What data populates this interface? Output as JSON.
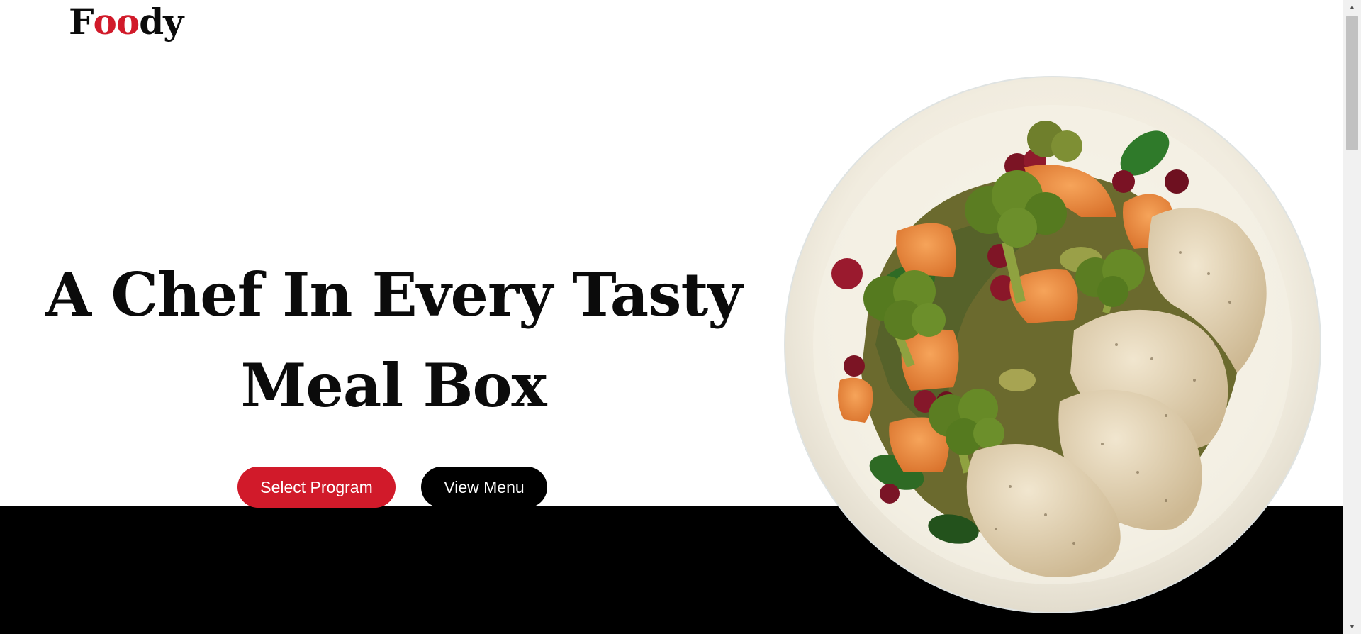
{
  "brand": {
    "logo_letters": [
      "F",
      "o",
      "o",
      "d",
      "y"
    ],
    "logo_accent_color": "#d11a2a",
    "logo_base_color": "#0b0b0b"
  },
  "hero": {
    "title_line_1": "A Chef In Every Tasty",
    "title_line_2": "Meal Box",
    "primary_button_label": "Select Program",
    "secondary_button_label": "View Menu",
    "primary_color": "#d11a2a",
    "secondary_color": "#000000",
    "image_alt": "plate-of-chicken-broccoli-and-sweet-potato-icon"
  },
  "footer_band": {
    "color": "#000000"
  }
}
